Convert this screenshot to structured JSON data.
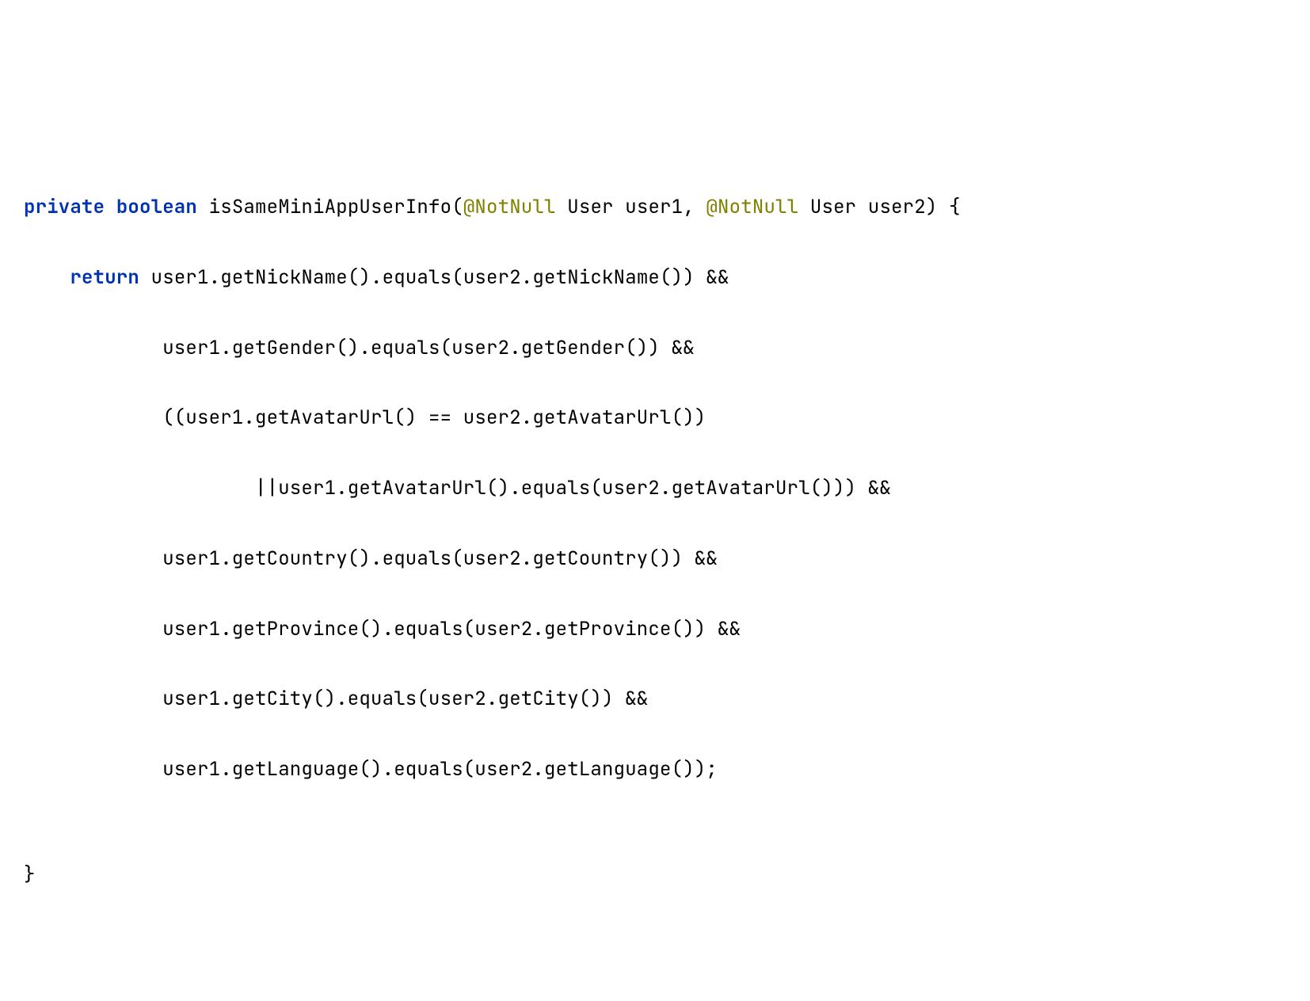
{
  "code": {
    "line1": {
      "kw_private": "private",
      "kw_boolean": "boolean",
      "method_name": " isSameMiniAppUserInfo(",
      "ann1": "@NotNull",
      "param1": " User user1, ",
      "ann2": "@NotNull",
      "param2": " User user2) {"
    },
    "line2": {
      "indent": "    ",
      "kw_return": "return",
      "rest": " user1.getNickName().equals(user2.getNickName()) &&"
    },
    "line3": {
      "text": "            user1.getGender().equals(user2.getGender()) &&"
    },
    "line4": {
      "text": "            ((user1.getAvatarUrl() == user2.getAvatarUrl())"
    },
    "line5": {
      "text": "                    ||user1.getAvatarUrl().equals(user2.getAvatarUrl())) &&"
    },
    "line6": {
      "text": "            user1.getCountry().equals(user2.getCountry()) &&"
    },
    "line7": {
      "text": "            user1.getProvince().equals(user2.getProvince()) &&"
    },
    "line8": {
      "text": "            user1.getCity().equals(user2.getCity()) &&"
    },
    "line9": {
      "text": "            user1.getLanguage().equals(user2.getLanguage());"
    },
    "line10": {
      "text": ""
    },
    "line11": {
      "text": "}"
    }
  }
}
